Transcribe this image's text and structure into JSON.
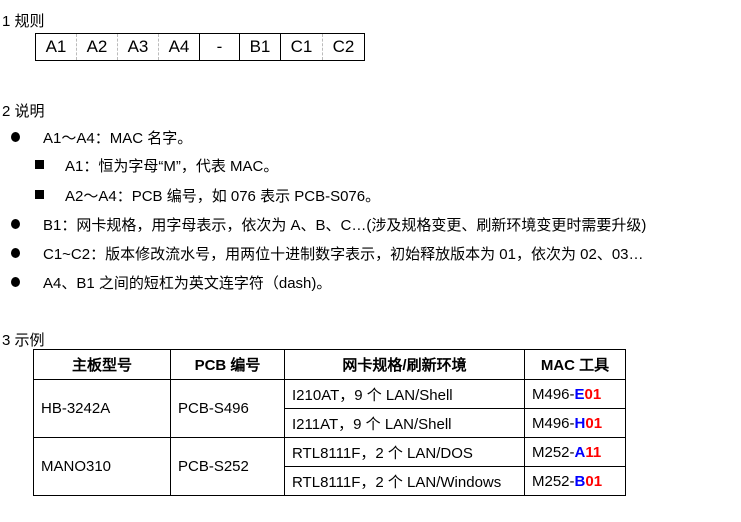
{
  "section1": {
    "title": "1 规则",
    "cells": [
      "A1",
      "A2",
      "A3",
      "A4",
      "-",
      "B1",
      "C1",
      "C2"
    ]
  },
  "section2": {
    "title": "2 说明",
    "items": [
      {
        "level": 1,
        "text": "A1～A4：MAC 名字。"
      },
      {
        "level": 2,
        "text": "A1：恒为字母“M”，代表 MAC。"
      },
      {
        "level": 2,
        "text": "A2～A4：PCB 编号，如 076 表示 PCB-S076。"
      },
      {
        "level": 1,
        "text": "B1：网卡规格，用字母表示，依次为 A、B、C…(涉及规格变更、刷新环境变更时需要升级)"
      },
      {
        "level": 1,
        "text": "C1~C2：版本修改流水号，用两位十进制数字表示，初始释放版本为 01，依次为 02、03…"
      },
      {
        "level": 1,
        "text": "A4、B1 之间的短杠为英文连字符（dash)。"
      }
    ]
  },
  "section3": {
    "title": "3 示例",
    "headers": [
      "主板型号",
      "PCB 编号",
      "网卡规格/刷新环境",
      "MAC 工具"
    ],
    "groups": [
      {
        "board": "HB-3242A",
        "pcb": "PCB-S496",
        "rows": [
          {
            "nic": "I210AT，9 个 LAN/Shell",
            "mac_prefix": "M496-",
            "mac_b1": "E",
            "mac_c": "01"
          },
          {
            "nic": "I211AT，9 个 LAN/Shell",
            "mac_prefix": "M496-",
            "mac_b1": "H",
            "mac_c": "01"
          }
        ]
      },
      {
        "board": "MANO310",
        "pcb": "PCB-S252",
        "rows": [
          {
            "nic": "RTL8111F，2 个 LAN/DOS",
            "mac_prefix": "M252-",
            "mac_b1": "A",
            "mac_c": "11"
          },
          {
            "nic": "RTL8111F，2 个 LAN/Windows",
            "mac_prefix": "M252-",
            "mac_b1": "B",
            "mac_c": "01"
          }
        ]
      }
    ]
  },
  "colors": {
    "b1_highlight": "#0000ff",
    "c_highlight": "#ff0000"
  }
}
